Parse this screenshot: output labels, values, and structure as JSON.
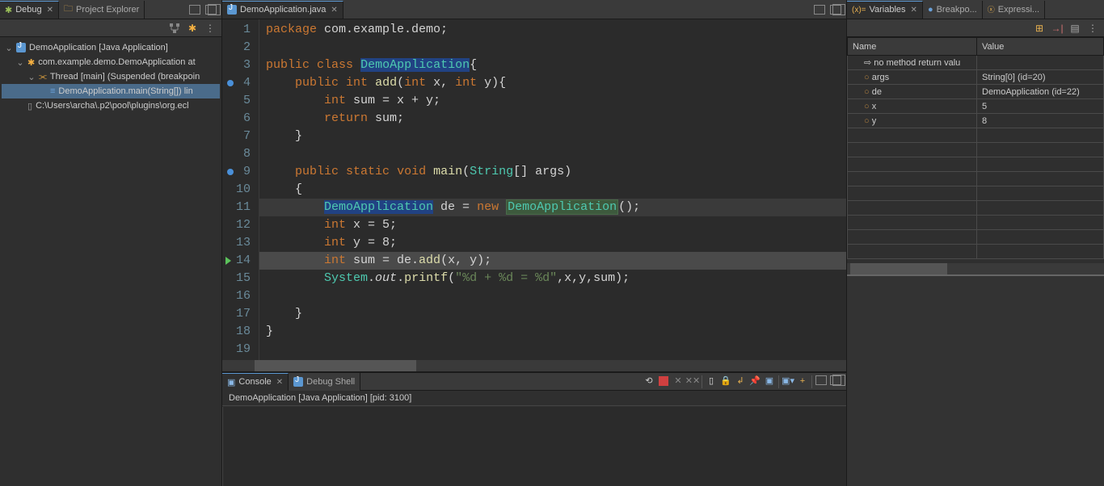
{
  "leftPanel": {
    "tabs": [
      {
        "label": "Debug",
        "active": true,
        "icon": "debug"
      },
      {
        "label": "Project Explorer",
        "active": false,
        "icon": "folder"
      }
    ],
    "tree": [
      {
        "depth": 0,
        "icon": "java-app",
        "label": "DemoApplication [Java Application]",
        "expanded": true
      },
      {
        "depth": 1,
        "icon": "gear",
        "label": "com.example.demo.DemoApplication at",
        "expanded": true
      },
      {
        "depth": 2,
        "icon": "thread",
        "label": "Thread [main] (Suspended (breakpoin",
        "expanded": true
      },
      {
        "depth": 3,
        "icon": "stack",
        "label": "DemoApplication.main(String[]) lin",
        "selected": true
      },
      {
        "depth": 1,
        "icon": "file",
        "label": "C:\\Users\\archa\\.p2\\pool\\plugins\\org.ecl"
      }
    ]
  },
  "editor": {
    "tab": "DemoApplication.java",
    "lines": [
      {
        "n": 1,
        "tokens": [
          [
            "kw",
            "package"
          ],
          [
            "id",
            " com.example.demo;"
          ]
        ]
      },
      {
        "n": 2,
        "tokens": []
      },
      {
        "n": 3,
        "tokens": [
          [
            "kw",
            "public"
          ],
          [
            "id",
            " "
          ],
          [
            "kw",
            "class"
          ],
          [
            "id",
            " "
          ],
          [
            "sel",
            "DemoApplication"
          ],
          [
            "id",
            "{"
          ]
        ]
      },
      {
        "n": 4,
        "bp": true,
        "tokens": [
          [
            "id",
            "    "
          ],
          [
            "kw",
            "public"
          ],
          [
            "id",
            " "
          ],
          [
            "kw",
            "int"
          ],
          [
            "id",
            " "
          ],
          [
            "fn",
            "add"
          ],
          [
            "id",
            "("
          ],
          [
            "kw",
            "int"
          ],
          [
            "id",
            " x, "
          ],
          [
            "kw",
            "int"
          ],
          [
            "id",
            " y){"
          ]
        ]
      },
      {
        "n": 5,
        "tokens": [
          [
            "id",
            "        "
          ],
          [
            "kw",
            "int"
          ],
          [
            "id",
            " sum = x + y;"
          ]
        ]
      },
      {
        "n": 6,
        "tokens": [
          [
            "id",
            "        "
          ],
          [
            "kw",
            "return"
          ],
          [
            "id",
            " sum;"
          ]
        ]
      },
      {
        "n": 7,
        "tokens": [
          [
            "id",
            "    }"
          ]
        ]
      },
      {
        "n": 8,
        "tokens": []
      },
      {
        "n": 9,
        "bp": true,
        "tokens": [
          [
            "id",
            "    "
          ],
          [
            "kw",
            "public"
          ],
          [
            "id",
            " "
          ],
          [
            "kw",
            "static"
          ],
          [
            "id",
            " "
          ],
          [
            "kw",
            "void"
          ],
          [
            "id",
            " "
          ],
          [
            "fn",
            "main"
          ],
          [
            "id",
            "("
          ],
          [
            "type",
            "String"
          ],
          [
            "id",
            "[] args)"
          ]
        ]
      },
      {
        "n": 10,
        "tokens": [
          [
            "id",
            "    {"
          ]
        ]
      },
      {
        "n": 11,
        "hl": true,
        "tokens": [
          [
            "id",
            "        "
          ],
          [
            "sel",
            "DemoApplication"
          ],
          [
            "id",
            " de = "
          ],
          [
            "kw",
            "new"
          ],
          [
            "id",
            " "
          ],
          [
            "occ",
            "DemoApplication"
          ],
          [
            "id",
            "();"
          ]
        ]
      },
      {
        "n": 12,
        "tokens": [
          [
            "id",
            "        "
          ],
          [
            "kw",
            "int"
          ],
          [
            "id",
            " x = 5;"
          ]
        ]
      },
      {
        "n": 13,
        "tokens": [
          [
            "id",
            "        "
          ],
          [
            "kw",
            "int"
          ],
          [
            "id",
            " y = 8;"
          ]
        ]
      },
      {
        "n": 14,
        "cur": true,
        "arrow": true,
        "tokens": [
          [
            "id",
            "        "
          ],
          [
            "kw",
            "int"
          ],
          [
            "id",
            " sum = de."
          ],
          [
            "fn",
            "add"
          ],
          [
            "id",
            "(x, y);"
          ]
        ]
      },
      {
        "n": 15,
        "tokens": [
          [
            "id",
            "        "
          ],
          [
            "type",
            "System"
          ],
          [
            "id",
            "."
          ],
          [
            "italic",
            "out"
          ],
          [
            "id",
            "."
          ],
          [
            "fn",
            "printf"
          ],
          [
            "id",
            "("
          ],
          [
            "str",
            "\"%d + %d = %d\""
          ],
          [
            "id",
            ",x,y,sum);"
          ]
        ]
      },
      {
        "n": 16,
        "tokens": []
      },
      {
        "n": 17,
        "tokens": [
          [
            "id",
            "    }"
          ]
        ]
      },
      {
        "n": 18,
        "tokens": [
          [
            "id",
            "}"
          ]
        ]
      },
      {
        "n": 19,
        "tokens": []
      }
    ]
  },
  "console": {
    "tabs": [
      {
        "label": "Console",
        "active": true
      },
      {
        "label": "Debug Shell",
        "active": false
      }
    ],
    "status": "DemoApplication [Java Application]  [pid: 3100]"
  },
  "rightPanel": {
    "tabs": [
      {
        "label": "Variables",
        "active": true
      },
      {
        "label": "Breakpo...",
        "active": false
      },
      {
        "label": "Expressi...",
        "active": false
      }
    ],
    "headers": {
      "name": "Name",
      "value": "Value"
    },
    "rows": [
      {
        "icon": "return",
        "name": "no method return valu",
        "value": ""
      },
      {
        "icon": "circle",
        "name": "args",
        "value": "String[0]  (id=20)"
      },
      {
        "icon": "circle",
        "name": "de",
        "value": "DemoApplication  (id=22)"
      },
      {
        "icon": "circle",
        "name": "x",
        "value": "5"
      },
      {
        "icon": "circle",
        "name": "y",
        "value": "8"
      }
    ],
    "emptyRows": 9
  }
}
